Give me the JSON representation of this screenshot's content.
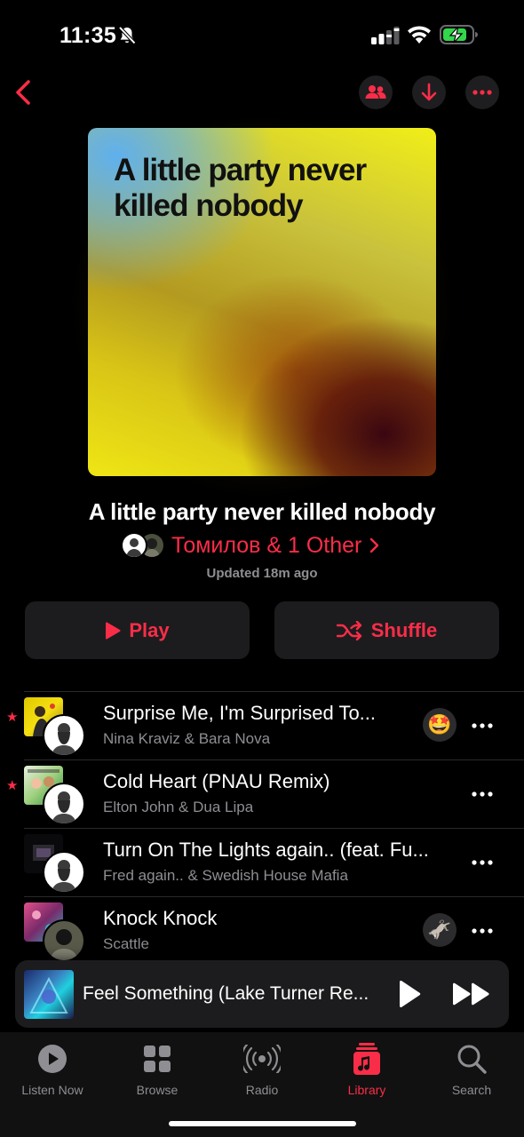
{
  "status_bar": {
    "time": "11:35"
  },
  "playlist": {
    "artwork_title": "A little party never killed nobody",
    "title": "A little party never killed nobody",
    "owner": "Томилов & 1 Other",
    "updated": "Updated 18m ago"
  },
  "actions": {
    "play_label": "Play",
    "shuffle_label": "Shuffle"
  },
  "tracks": [
    {
      "title": "Surprise Me, I'm Surprised To...",
      "artist": "Nina Kraviz & Bara Nova",
      "starred": true,
      "reaction": "🤩"
    },
    {
      "title": "Cold Heart (PNAU Remix)",
      "artist": "Elton John & Dua Lipa",
      "starred": true,
      "reaction": ""
    },
    {
      "title": "Turn On The Lights again.. (feat. Fu...",
      "artist": "Fred again.. & Swedish House Mafia",
      "starred": false,
      "reaction": ""
    },
    {
      "title": "Knock Knock",
      "artist": "Scattle",
      "starred": false,
      "reaction": "🫏"
    }
  ],
  "now_playing": {
    "title": "Feel Something (Lake Turner Re..."
  },
  "tabs": [
    {
      "label": "Listen Now",
      "icon": "play-circle-icon"
    },
    {
      "label": "Browse",
      "icon": "grid-icon"
    },
    {
      "label": "Radio",
      "icon": "radio-icon"
    },
    {
      "label": "Library",
      "icon": "library-icon",
      "active": true
    },
    {
      "label": "Search",
      "icon": "search-icon"
    }
  ],
  "colors": {
    "accent": "#fa2d48",
    "background": "#000000",
    "surface": "#1c1c1e",
    "secondary_text": "#8e8e93"
  }
}
